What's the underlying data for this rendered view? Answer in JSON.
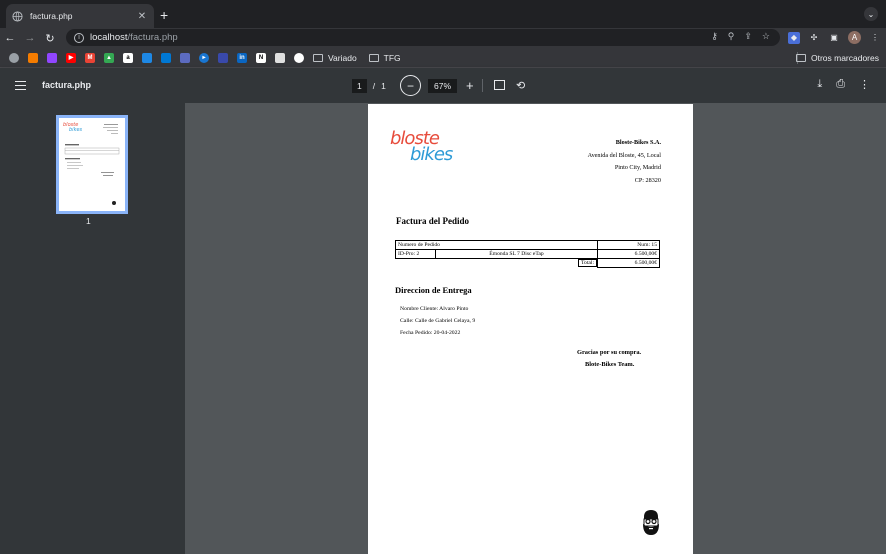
{
  "browser": {
    "tab_title": "factura.php",
    "tab_close": "✕",
    "new_tab": "+",
    "url_host": "localhost",
    "url_path": "/factura.php",
    "avatar_letter": "A",
    "bookmark_folders": [
      "Variado",
      "TFG"
    ],
    "other_bookmarks": "Otros marcadores"
  },
  "pdf_toolbar": {
    "filename": "factura.php",
    "current_page": "1",
    "separator": "/",
    "total_pages": "1",
    "zoom": "67%",
    "zoom_out": "−",
    "zoom_in": "+"
  },
  "sidebar": {
    "thumbnail_page_number": "1"
  },
  "document": {
    "company": {
      "name": "Bloste-Bikes S.A.",
      "address": "Avenida del Bloste, 45, Local",
      "city": "Pinto City, Madrid",
      "postal": "CP: 28320"
    },
    "invoice_title": "Factura del Pedido",
    "table": {
      "order_label": "Numero de Pedido",
      "order_num": "Num: 15",
      "product_id": "ID-Pro: 2",
      "product_name": "Émonda SL 7 Disc eTap",
      "product_price": "6.500,00€",
      "total_label": "Total:",
      "total_value": "6.500,00€"
    },
    "delivery_title": "Direccion de Entrega",
    "customer": "Nombre Cliente: Alvaro Pinto",
    "street": "Calle: Calle de Gabriel Celaya, 9",
    "order_date": "Fecha Pedido: 20-04-2022",
    "thanks_1": "Gracias por su compra.",
    "thanks_2": "Blote-Bikes Team."
  },
  "colors": {
    "logo_red": "#e74c3c",
    "logo_blue": "#2e9bd6",
    "thumb_border": "#8ab4f8",
    "viewer_bg": "#525659",
    "toolbar_bg": "#323639"
  }
}
